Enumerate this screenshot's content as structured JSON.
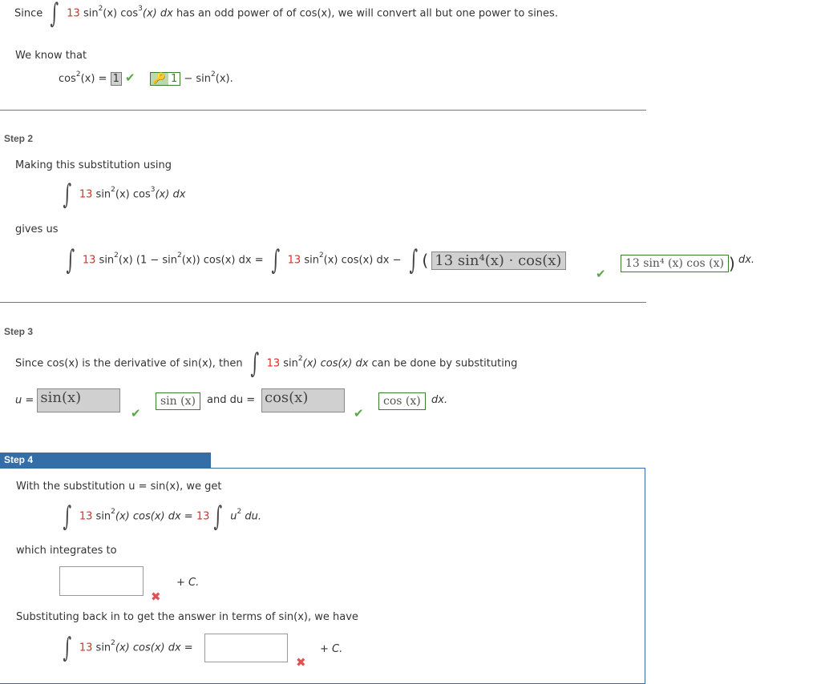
{
  "step1": {
    "since": "Since",
    "coef": "13",
    "integrand": "sin",
    "sin_pow": "2",
    "cos_part": "(x) cos",
    "cos_pow": "3",
    "tail": "(x) dx",
    "explanation": "has an odd power of of cos(x), we will convert all but one power to sines.",
    "we_know": "We know that",
    "identity_lhs": "cos",
    "identity_pow": "2",
    "identity_lhs_tail": "(x) =",
    "entered_value": "1",
    "answer_value": "1",
    "identity_rhs": "− sin",
    "identity_rhs_pow": "2",
    "identity_rhs_tail": "(x)."
  },
  "step2": {
    "label": "Step 2",
    "making": "Making this substitution using",
    "coef": "13",
    "expr_sin": "sin",
    "expr_sin_pow": "2",
    "expr_mid": "(x) cos",
    "expr_cos_pow": "3",
    "expr_tail": "(x) dx",
    "gives_us": "gives us",
    "lhs_coef": "13",
    "lhs_a": "sin",
    "lhs_pow1": "2",
    "lhs_b": "(x) (1 − sin",
    "lhs_pow2": "2",
    "lhs_c": "(x)) cos(x) dx",
    "eq": "=",
    "rhs_coef": "13",
    "rhs_a": "sin",
    "rhs_pow": "2",
    "rhs_b": "(x) cos(x) dx",
    "minus": "−",
    "entered_answer": "13 sin⁴(x) · cos(x)",
    "correct_answer": "13 sin⁴ (x) cos (x)",
    "dx": "dx."
  },
  "step3": {
    "label": "Step 3",
    "since_text": "Since cos(x) is the derivative of sin(x), then",
    "coef": "13",
    "expr_a": "sin",
    "expr_pow": "2",
    "expr_b": "(x) cos(x) dx",
    "can_be_done": "can be done by substituting",
    "u_eq": "u =",
    "u_entered": "sin(x)",
    "u_answer": "sin (x)",
    "and_du": "and du =",
    "du_entered": "cos(x)",
    "du_answer": "cos (x)",
    "dx": "dx."
  },
  "step4": {
    "label": "Step 4",
    "with_sub": "With the substitution u = sin(x), we get",
    "coef": "13",
    "expr_a": "sin",
    "expr_pow": "2",
    "expr_b": "(x) cos(x) dx =",
    "rhs_coef": "13",
    "rhs_u": "u",
    "rhs_pow": "2",
    "rhs_du": "du.",
    "integrates_to": "which integrates to",
    "input1_value": "",
    "plus_c": "+ C.",
    "substituting_back": "Substituting back in to get the answer in terms of sin(x), we have",
    "final_coef": "13",
    "final_a": "sin",
    "final_pow": "2",
    "final_b": "(x) cos(x) dx =",
    "input2_value": "",
    "plus_c2": "+ C."
  },
  "colors": {
    "accent": "#336ea8",
    "coef_red": "#e12a2a",
    "correct_green": "#5aa648",
    "incorrect_red": "#e05050"
  }
}
